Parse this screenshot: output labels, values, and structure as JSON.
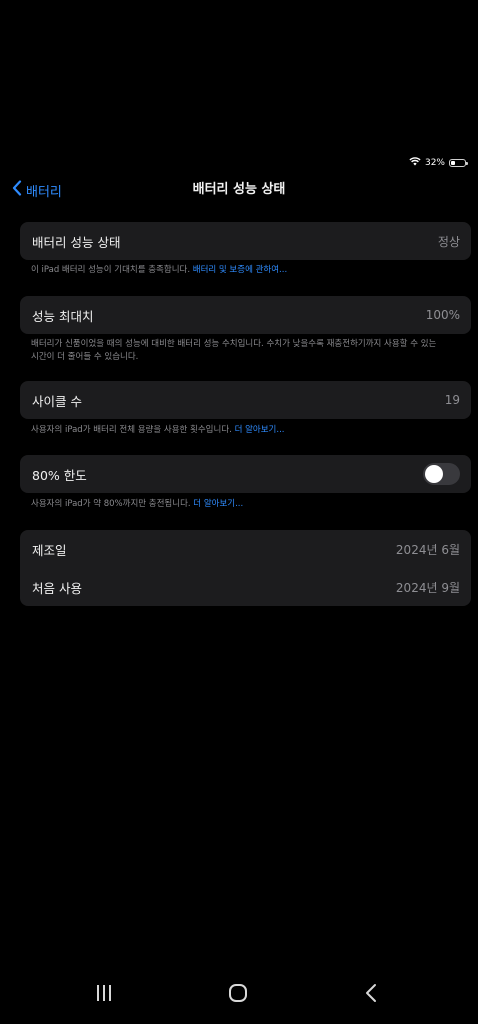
{
  "status": {
    "battery_percent": "32%",
    "battery_level": 0.32
  },
  "nav": {
    "back_label": "배터리",
    "title": "배터리 성능 상태"
  },
  "health": {
    "label": "배터리 성능 상태",
    "value": "정상",
    "footnote": "이 iPad 배터리 성능이 기대치를 충족합니다.",
    "footnote_link": "배터리 및 보증에 관하여..."
  },
  "capacity": {
    "label": "성능 최대치",
    "value": "100%",
    "footnote_line1": "배터리가 신품이었을 때의 성능에 대비한 배터리 성능 수치입니다. 수치가 낮을수록 재충전하기까지 사용할 수 있는",
    "footnote_line2": "시간이 더 줄어들 수 있습니다."
  },
  "cycles": {
    "label": "사이클 수",
    "value": "19",
    "footnote": "사용자의 iPad가 배터리 전체 용량을 사용한 횟수입니다.",
    "footnote_link": "더 알아보기..."
  },
  "limit": {
    "label": "80% 한도",
    "enabled": false,
    "footnote": "사용자의 iPad가 약 80%까지만 충전됩니다.",
    "footnote_link": "더 알아보기..."
  },
  "dates": {
    "manufactured_label": "제조일",
    "manufactured_value": "2024년 6월",
    "first_use_label": "처음 사용",
    "first_use_value": "2024년 9월"
  },
  "colors": {
    "background": "#000000",
    "card": "#1c1c1e",
    "accent": "#2f8cff",
    "secondary_text": "#8e8e93"
  },
  "icons": {
    "wifi": "wifi-icon",
    "battery": "battery-icon",
    "back": "chevron-left-icon",
    "recents": "recents-icon",
    "home": "home-icon",
    "system_back": "system-back-icon"
  }
}
